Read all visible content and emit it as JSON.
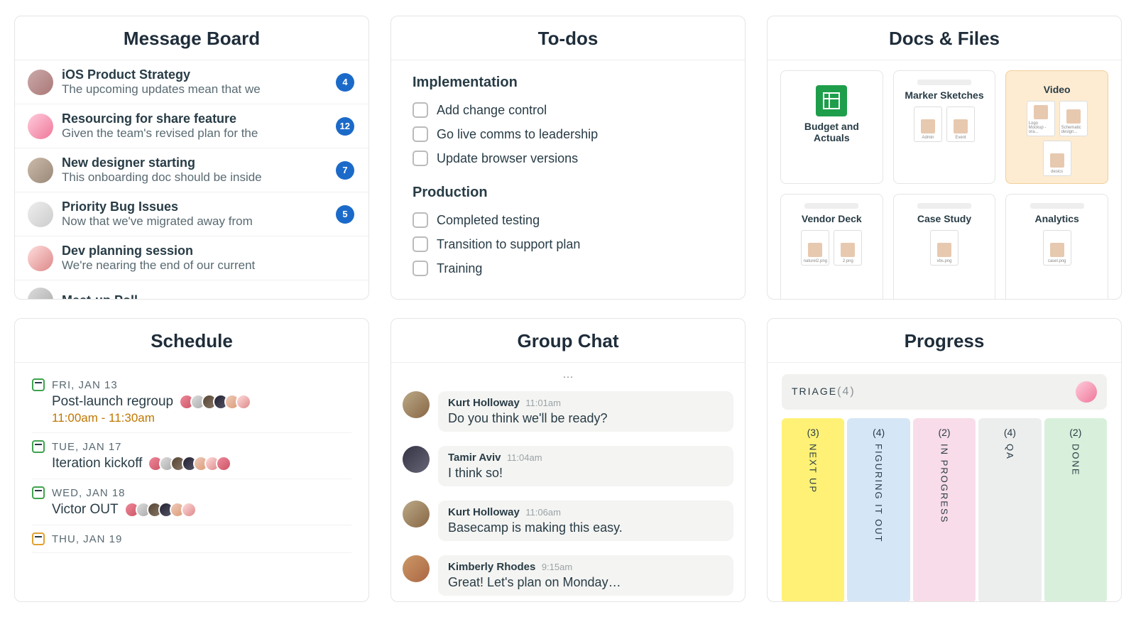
{
  "cards": {
    "message_board": {
      "title": "Message Board",
      "items": [
        {
          "title": "iOS Product Strategy",
          "preview": "The upcoming updates mean that we",
          "badge": 4
        },
        {
          "title": "Resourcing for share feature",
          "preview": "Given the team's revised plan for the",
          "badge": 12
        },
        {
          "title": "New designer starting",
          "preview": "This onboarding doc should be inside",
          "badge": 7
        },
        {
          "title": "Priority Bug Issues",
          "preview": "Now that we've migrated away from",
          "badge": 5
        },
        {
          "title": "Dev planning session",
          "preview": "We're nearing the end of our current",
          "badge": null
        },
        {
          "title": "Meet-up Poll",
          "preview": "",
          "badge": null
        }
      ]
    },
    "todos": {
      "title": "To-dos",
      "groups": [
        {
          "name": "Implementation",
          "items": [
            "Add change control",
            "Go live comms to leadership",
            "Update browser versions"
          ]
        },
        {
          "name": "Production",
          "items": [
            "Completed testing",
            "Transition to support plan",
            "Training"
          ]
        }
      ]
    },
    "docs": {
      "title": "Docs & Files",
      "tiles": [
        {
          "name": "Budget and Actuals",
          "type": "sheet"
        },
        {
          "name": "Marker Sketches",
          "type": "folder",
          "thumbs": [
            "Admin",
            "Event"
          ]
        },
        {
          "name": "Video",
          "type": "folder",
          "highlight": true,
          "thumbs": [
            "Logo Mockup - ora...",
            "Schematic design...",
            "desics"
          ]
        },
        {
          "name": "Vendor Deck",
          "type": "folder",
          "thumbs": [
            "naturel2.png",
            "2.png"
          ]
        },
        {
          "name": "Case Study",
          "type": "folder",
          "thumbs": [
            "vbs.png"
          ]
        },
        {
          "name": "Analytics",
          "type": "folder",
          "thumbs": [
            "casel.png"
          ]
        }
      ]
    },
    "schedule": {
      "title": "Schedule",
      "events": [
        {
          "date": "FRI, JAN 13",
          "name": "Post-launch regroup",
          "time": "11:00am - 11:30am",
          "color": "green",
          "avatars": 6
        },
        {
          "date": "TUE, JAN 17",
          "name": "Iteration kickoff",
          "time": null,
          "color": "green",
          "avatars": 7
        },
        {
          "date": "WED, JAN 18",
          "name": "Victor OUT",
          "time": null,
          "color": "green",
          "avatars": 6
        },
        {
          "date": "THU, JAN 19",
          "name": null,
          "time": null,
          "color": "orange",
          "avatars": 0
        }
      ]
    },
    "chat": {
      "title": "Group Chat",
      "messages": [
        {
          "name": "Kurt Holloway",
          "time": "11:01am",
          "text": "Do you think we'll be ready?"
        },
        {
          "name": "Tamir Aviv",
          "time": "11:04am",
          "text": "I think so!"
        },
        {
          "name": "Kurt Holloway",
          "time": "11:06am",
          "text": "Basecamp is making this easy."
        },
        {
          "name": "Kimberly Rhodes",
          "time": "9:15am",
          "text": "Great! Let's plan on Monday…"
        }
      ]
    },
    "progress": {
      "title": "Progress",
      "triage": {
        "label": "TRIAGE",
        "count": 4
      },
      "columns": [
        {
          "label": "NEXT UP",
          "count": 3,
          "color": "yellow"
        },
        {
          "label": "FIGURING IT OUT",
          "count": 4,
          "color": "blue"
        },
        {
          "label": "IN PROGRESS",
          "count": 2,
          "color": "pink"
        },
        {
          "label": "QA",
          "count": 4,
          "color": "gray"
        },
        {
          "label": "DONE",
          "count": 2,
          "color": "green"
        }
      ]
    }
  }
}
